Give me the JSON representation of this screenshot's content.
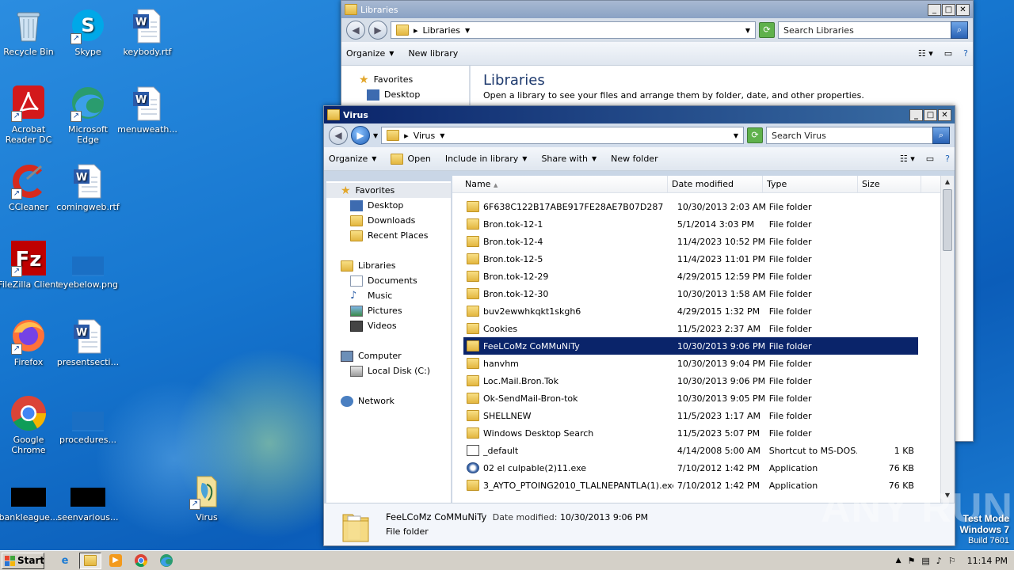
{
  "desktop": {
    "icons": [
      {
        "label": "Recycle Bin",
        "icon": "recycle-bin-icon"
      },
      {
        "label": "Skype",
        "icon": "skype-icon"
      },
      {
        "label": "keybody.rtf",
        "icon": "word-doc-icon"
      },
      {
        "label": "Acrobat Reader DC",
        "icon": "acrobat-icon"
      },
      {
        "label": "Microsoft Edge",
        "icon": "edge-icon"
      },
      {
        "label": "menuweath...",
        "icon": "word-doc-icon"
      },
      {
        "label": "CCleaner",
        "icon": "ccleaner-icon"
      },
      {
        "label": "comingweb.rtf",
        "icon": "word-doc-icon"
      },
      {
        "label": "FileZilla Client",
        "icon": "filezilla-icon"
      },
      {
        "label": "eyebelow.png",
        "icon": "image-file-icon"
      },
      {
        "label": "Firefox",
        "icon": "firefox-icon"
      },
      {
        "label": "presentsecti...",
        "icon": "word-doc-icon"
      },
      {
        "label": "Google Chrome",
        "icon": "chrome-icon"
      },
      {
        "label": "procedures...",
        "icon": "image-file-icon"
      },
      {
        "label": "bankleague...",
        "icon": "black-thumbnail-icon"
      },
      {
        "label": "seenvarious...",
        "icon": "black-thumbnail-icon"
      },
      {
        "label": "Virus",
        "icon": "virus-folder-icon"
      }
    ]
  },
  "libraries_window": {
    "title": "Libraries",
    "address": "Libraries",
    "search_placeholder": "Search Libraries",
    "cmd": {
      "organize": "Organize",
      "new_library": "New library"
    },
    "nav": {
      "favorites": "Favorites",
      "desktop": "Desktop"
    },
    "heading": "Libraries",
    "subtext": "Open a library to see your files and arrange them by folder, date, and other properties."
  },
  "virus_window": {
    "title": "Virus",
    "address": "Virus",
    "search_placeholder": "Search Virus",
    "cmd": {
      "organize": "Organize",
      "open": "Open",
      "include": "Include in library",
      "share": "Share with",
      "new_folder": "New folder"
    },
    "nav": {
      "favorites": "Favorites",
      "desktop": "Desktop",
      "downloads": "Downloads",
      "recent": "Recent Places",
      "libraries": "Libraries",
      "documents": "Documents",
      "music": "Music",
      "pictures": "Pictures",
      "videos": "Videos",
      "computer": "Computer",
      "local_disk": "Local Disk (C:)",
      "network": "Network"
    },
    "columns": {
      "name": "Name",
      "date": "Date modified",
      "type": "Type",
      "size": "Size"
    },
    "files": [
      {
        "name": "6F638C122B17ABE917FE28AE7B07D287",
        "date": "10/30/2013 2:03 AM",
        "type": "File folder",
        "size": "",
        "icon": "folder"
      },
      {
        "name": "Bron.tok-12-1",
        "date": "5/1/2014 3:03 PM",
        "type": "File folder",
        "size": "",
        "icon": "folder"
      },
      {
        "name": "Bron.tok-12-4",
        "date": "11/4/2023 10:52 PM",
        "type": "File folder",
        "size": "",
        "icon": "folder"
      },
      {
        "name": "Bron.tok-12-5",
        "date": "11/4/2023 11:01 PM",
        "type": "File folder",
        "size": "",
        "icon": "folder"
      },
      {
        "name": "Bron.tok-12-29",
        "date": "4/29/2015 12:59 PM",
        "type": "File folder",
        "size": "",
        "icon": "folder"
      },
      {
        "name": "Bron.tok-12-30",
        "date": "10/30/2013 1:58 AM",
        "type": "File folder",
        "size": "",
        "icon": "folder"
      },
      {
        "name": "buv2ewwhkqkt1skgh6",
        "date": "4/29/2015 1:32 PM",
        "type": "File folder",
        "size": "",
        "icon": "folder"
      },
      {
        "name": "Cookies",
        "date": "11/5/2023 2:37 AM",
        "type": "File folder",
        "size": "",
        "icon": "folder"
      },
      {
        "name": "FeeLCoMz CoMMuNiTy",
        "date": "10/30/2013 9:06 PM",
        "type": "File folder",
        "size": "",
        "icon": "folder",
        "selected": true
      },
      {
        "name": "hanvhm",
        "date": "10/30/2013 9:04 PM",
        "type": "File folder",
        "size": "",
        "icon": "folder"
      },
      {
        "name": "Loc.Mail.Bron.Tok",
        "date": "10/30/2013 9:06 PM",
        "type": "File folder",
        "size": "",
        "icon": "folder"
      },
      {
        "name": "Ok-SendMail-Bron-tok",
        "date": "10/30/2013 9:05 PM",
        "type": "File folder",
        "size": "",
        "icon": "folder"
      },
      {
        "name": "SHELLNEW",
        "date": "11/5/2023 1:17 AM",
        "type": "File folder",
        "size": "",
        "icon": "folder"
      },
      {
        "name": "Windows Desktop Search",
        "date": "11/5/2023 5:07 PM",
        "type": "File folder",
        "size": "",
        "icon": "folder"
      },
      {
        "name": "_default",
        "date": "4/14/2008 5:00 AM",
        "type": "Shortcut to MS-DOS...",
        "size": "1 KB",
        "icon": "shortcut"
      },
      {
        "name": "02 el culpable(2)11.exe",
        "date": "7/10/2012 1:42 PM",
        "type": "Application",
        "size": "76 KB",
        "icon": "app"
      },
      {
        "name": "3_AYTO_PTOING2010_TLALNEPANTLA(1).exe",
        "date": "7/10/2012 1:42 PM",
        "type": "Application",
        "size": "76 KB",
        "icon": "folder"
      }
    ],
    "details": {
      "name": "FeeLCoMz CoMMuNiTy",
      "date_label": "Date modified:",
      "date_value": "10/30/2013 9:06 PM",
      "type": "File folder"
    }
  },
  "taskbar": {
    "start": "Start",
    "icons": [
      "ie-icon",
      "explorer-icon",
      "media-player-icon",
      "chrome-icon",
      "edge-icon"
    ],
    "time": "11:14 PM"
  },
  "watermark": {
    "line1": "Test Mode",
    "line2": "Windows 7",
    "line3": "Build 7601",
    "brand": "ANY RUN"
  }
}
